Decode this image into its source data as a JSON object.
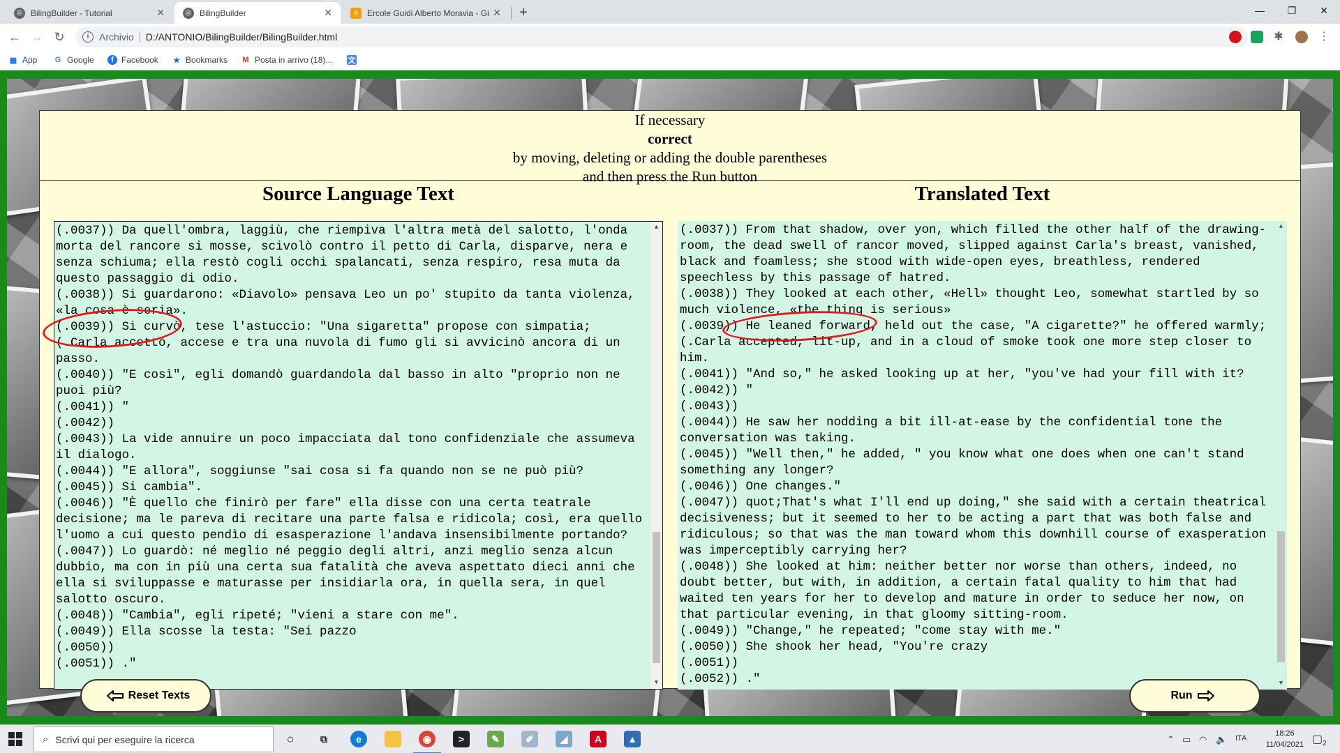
{
  "browser": {
    "tabs": [
      {
        "label": "BilingBuilder - Tutorial",
        "active": false,
        "icon": "globe-icon"
      },
      {
        "label": "BilingBuilder",
        "active": true,
        "icon": "globe-icon"
      },
      {
        "label": "Ercole Guidi Alberto Moravia - Gi",
        "active": false,
        "icon": "amazon-icon"
      }
    ],
    "address": {
      "scheme": "Archivio",
      "url": "D:/ANTONIO/BilingBuilder/BilingBuilder.html"
    },
    "bookmarks": [
      {
        "label": "App",
        "icon": "apps-grid-icon"
      },
      {
        "label": "Google",
        "icon": "google-icon"
      },
      {
        "label": "Facebook",
        "icon": "facebook-icon"
      },
      {
        "label": "Bookmarks",
        "icon": "star-icon"
      },
      {
        "label": "Posta in arrivo (18)...",
        "icon": "gmail-icon"
      },
      {
        "label": "",
        "icon": "translate-icon"
      }
    ]
  },
  "app": {
    "instructions": {
      "line1": "If necessary",
      "line2": "correct",
      "line3": "by moving, deleting or adding the double parentheses",
      "line4": "and then press the Run button"
    },
    "source_title": "Source Language Text",
    "target_title": "Translated Text",
    "reset_label": "Reset Texts",
    "run_label": "Run",
    "source_lines": [
      "(.0037)) Da quell'ombra, laggiù, che riempiva l'altra metà del salotto, l'onda morta del rancore si mosse, scivolò contro il petto di Carla, disparve, nera e senza schiuma; ella restò cogli occhi spalancati, senza respiro, resa muta da questo passaggio di odio.",
      "(.0038)) Si guardarono: «Diavolo» pensava Leo un po' stupito da tanta violenza, «la cosa è seria».",
      "(.0039)) Si curvò, tese l'astuccio: \"Una sigaretta\" propose con simpatia; (.Carla accettò, accese e tra una nuvola di fumo gli si avvicinò ancora di un passo.",
      "(.0040)) \"E così\", egli domandò guardandola dal basso in alto \"proprio non ne puoi più?",
      "(.0041)) \"",
      "(.0042))",
      "(.0043)) La vide annuire un poco impacciata dal tono confidenziale che assumeva il dialogo.",
      "(.0044)) \"E allora\", soggiunse \"sai cosa si fa quando non se ne può più?",
      "(.0045)) Si cambia\".",
      "(.0046)) \"È quello che finirò per fare\" ella disse con una certa teatrale decisione; ma le pareva di recitare una parte falsa e ridicola; così, era quello l'uomo a cui questo pendìo di esasperazione l'andava insensibilmente portando?",
      "(.0047)) Lo guardò: né meglio né peggio degli altri, anzi meglio senza alcun dubbio, ma con in più una certa sua fatalità che aveva aspettato dieci anni che ella si sviluppasse e maturasse per insidiarla ora, in quella sera, in quel salotto oscuro.",
      "(.0048)) \"Cambia\", egli ripeté; \"vieni a stare con me\".",
      "(.0049)) Ella scosse la testa: \"Sei pazzo",
      "(.0050))",
      "(.0051)) .\""
    ],
    "target_lines": [
      "(.0037)) From that shadow, over yon, which filled the other half of the drawing-room, the dead swell of rancor moved, slipped against Carla's breast, vanished, black and foamless; she stood with wide-open eyes, breathless, rendered speechless by this passage of hatred.",
      "(.0038)) They looked at each other, «Hell» thought Leo, somewhat startled by so much violence, «the thing is serious»",
      "(.0039)) He leaned forward, held out the case, \"A cigarette?\" he offered warmly; (.Carla accepted, lit-up, and in a cloud of smoke took one more step closer to him.",
      "(.0041)) \"And so,\" he asked looking up at her, \"you've had your fill with it?",
      "(.0042)) \"",
      "(.0043))",
      "(.0044)) He saw her nodding a bit ill-at-ease by the confidential tone the conversation was taking.",
      "(.0045)) \"Well then,\" he added, \" you know what one does when one can't stand something any longer?",
      "(.0046)) One changes.\"",
      "(.0047)) quot;That's what I'll end up doing,\" she said with a certain theatrical decisiveness; but it seemed to her to be acting a part that was both false and ridiculous; so that was the man toward whom this downhill course of exasperation was imperceptibly carrying her?",
      "(.0048)) She looked at him: neither better nor worse than others, indeed, no doubt better, but with, in addition, a certain fatal quality to him that had waited ten years for her to develop and mature in order to seduce her now, on that particular evening, in that gloomy sitting-room.",
      "(.0049)) \"Change,\" he repeated; \"come stay with me.\"",
      "(.0050)) She shook her head, \"You're crazy",
      "(.0051))",
      "(.0052)) .\""
    ]
  },
  "taskbar": {
    "search_placeholder": "Scrivi qui per eseguire la ricerca",
    "language": "ITA",
    "time": "18:26",
    "date": "11/04/2021",
    "notifications": "2"
  },
  "colors": {
    "accent_green": "#1a8a1a",
    "panel": "#fffdd8",
    "textbox": "#d3f5e6",
    "ring": "#e01d1d"
  }
}
